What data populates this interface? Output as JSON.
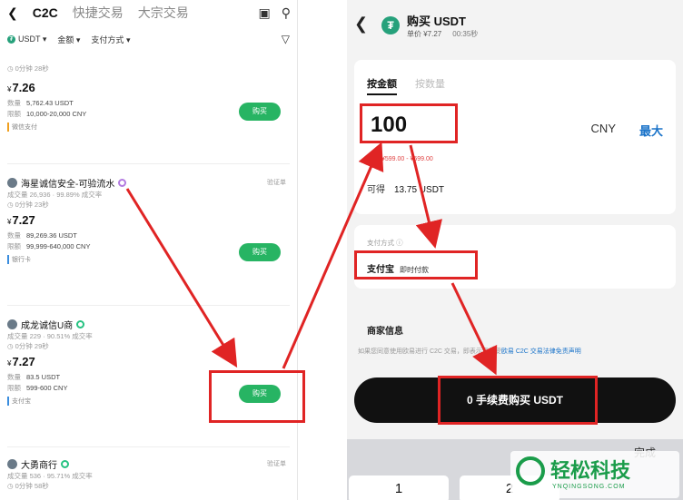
{
  "left": {
    "tabs": [
      "C2C",
      "快捷交易",
      "大宗交易"
    ],
    "filters": [
      "USDT",
      "金额",
      "支付方式"
    ],
    "cards": [
      {
        "stats": "0分钟 28秒",
        "price": "7.26",
        "currency": "¥",
        "qty_label": "数量",
        "qty": "5,762.43 USDT",
        "limit_label": "限额",
        "limit": "10,000-20,000 CNY",
        "pay": "微信支付",
        "buy": "购买"
      },
      {
        "merchant": "海星诚信安全-可验流水",
        "verify": "验证单",
        "stats": "成交量 26,936 · 99.89% 成交率",
        "time": "0分钟 23秒",
        "price": "7.27",
        "currency": "¥",
        "qty_label": "数量",
        "qty": "89,269.36 USDT",
        "limit_label": "限额",
        "limit": "99,999-640,000 CNY",
        "pay": "银行卡",
        "buy": "购买"
      },
      {
        "merchant": "成龙诚信U商",
        "stats": "成交量 229 · 90.51% 成交率",
        "time": "0分钟 29秒",
        "price": "7.27",
        "currency": "¥",
        "qty_label": "数量",
        "qty": "83.5 USDT",
        "limit_label": "限额",
        "limit": "599-600 CNY",
        "pay": "支付宝",
        "buy": "购买"
      },
      {
        "merchant": "大勇商行",
        "verify": "验证单",
        "stats": "成交量 536 · 95.71% 成交率",
        "time": "0分钟 58秒"
      }
    ]
  },
  "right": {
    "title": "购买 USDT",
    "unit_price": "单价 ¥7.27",
    "timer": "00:35秒",
    "tab_amount": "按金额",
    "tab_qty": "按数量",
    "amount": "100",
    "currency": "CNY",
    "max": "最大",
    "limit_note": "限额 ¥599.00 - ¥599.00",
    "receive_label": "可得",
    "receive_value": "13.75 USDT",
    "pay_section_label": "支付方式 ⓘ",
    "pay_method": "支付宝",
    "pay_method_sub": "即时付款",
    "merchant_info": "商家信息",
    "terms_text": "如果您同意使用欧易进行 C2C 交易，即表示您接受",
    "terms_link": "欧易 C2C 交易法律免责声明",
    "cta": "0 手续费购买 USDT",
    "done": "完成",
    "keys": [
      "1",
      "2"
    ]
  },
  "watermark": {
    "text": "轻松科技",
    "url": "YNQINGSONG.COM"
  },
  "colors": {
    "buy_green": "#27b463",
    "annotation_red": "#e02424",
    "link_blue": "#1a73c9",
    "tether_green": "#26a17b"
  }
}
